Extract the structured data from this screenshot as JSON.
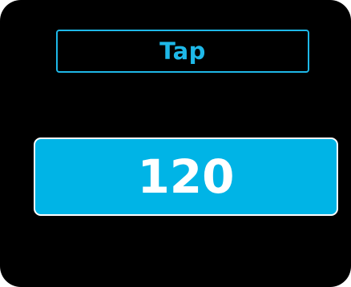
{
  "tap_button": {
    "label": "Tap"
  },
  "tempo": {
    "value": "120"
  },
  "colors": {
    "background": "#000000",
    "accent": "#1eb8e8",
    "display_fill": "#00b4e6",
    "display_text": "#ffffff"
  }
}
